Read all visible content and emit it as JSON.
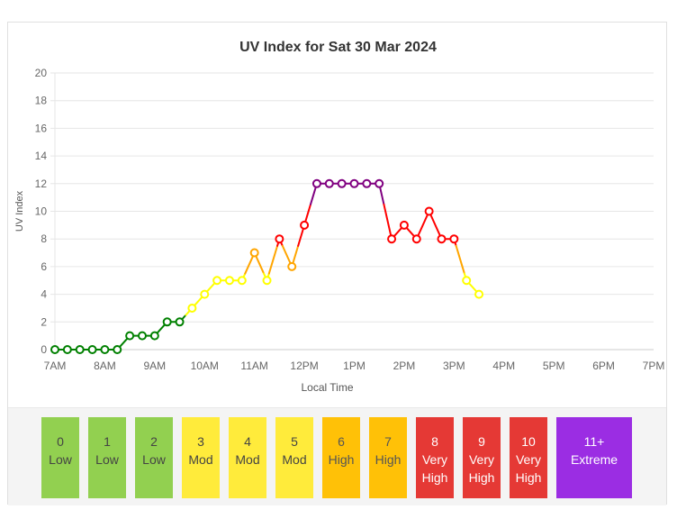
{
  "chart_data": {
    "type": "line",
    "title": "UV Index for Sat 30 Mar 2024",
    "xlabel": "Local Time",
    "ylabel": "UV Index",
    "ylim": [
      0,
      20
    ],
    "yticks": [
      0,
      2,
      4,
      6,
      8,
      10,
      12,
      14,
      16,
      18,
      20
    ],
    "xlim_hours": [
      7,
      19
    ],
    "xticks": [
      {
        "hour": 7,
        "label": "7AM"
      },
      {
        "hour": 8,
        "label": "8AM"
      },
      {
        "hour": 9,
        "label": "9AM"
      },
      {
        "hour": 10,
        "label": "10AM"
      },
      {
        "hour": 11,
        "label": "11AM"
      },
      {
        "hour": 12,
        "label": "12PM"
      },
      {
        "hour": 13,
        "label": "1PM"
      },
      {
        "hour": 14,
        "label": "2PM"
      },
      {
        "hour": 15,
        "label": "3PM"
      },
      {
        "hour": 16,
        "label": "4PM"
      },
      {
        "hour": 17,
        "label": "5PM"
      },
      {
        "hour": 18,
        "label": "6PM"
      },
      {
        "hour": 19,
        "label": "7PM"
      }
    ],
    "grid": true,
    "series": [
      {
        "name": "UV Index",
        "x_hours": [
          7,
          7.25,
          7.5,
          7.75,
          8,
          8.25,
          8.5,
          8.75,
          9,
          9.25,
          9.5,
          9.75,
          10,
          10.25,
          10.5,
          10.75,
          11,
          11.25,
          11.5,
          11.75,
          12,
          12.25,
          12.5,
          12.75,
          13,
          13.25,
          13.5,
          13.75,
          14,
          14.25,
          14.5,
          14.75,
          15,
          15.25,
          15.5
        ],
        "values": [
          0,
          0,
          0,
          0,
          0,
          0,
          1,
          1,
          1,
          2,
          2,
          3,
          4,
          5,
          5,
          5,
          7,
          5,
          8,
          6,
          9,
          12,
          12,
          12,
          12,
          12,
          12,
          8,
          9,
          8,
          10,
          8,
          8,
          5,
          4
        ]
      }
    ],
    "color_bands": [
      {
        "min": 0,
        "max": 2.5,
        "color": "#008000"
      },
      {
        "min": 2.5,
        "max": 5.5,
        "color": "#ffff00"
      },
      {
        "min": 5.5,
        "max": 7.5,
        "color": "#ffa500"
      },
      {
        "min": 7.5,
        "max": 10.5,
        "color": "#ff0000"
      },
      {
        "min": 10.5,
        "max": 100,
        "color": "#800080"
      }
    ]
  },
  "legend": [
    {
      "value": "0",
      "lines": [
        "Low"
      ],
      "bg": "#92d050",
      "fg": "#444444"
    },
    {
      "value": "1",
      "lines": [
        "Low"
      ],
      "bg": "#92d050",
      "fg": "#444444"
    },
    {
      "value": "2",
      "lines": [
        "Low"
      ],
      "bg": "#92d050",
      "fg": "#444444"
    },
    {
      "value": "3",
      "lines": [
        "Mod"
      ],
      "bg": "#ffeb3b",
      "fg": "#444444"
    },
    {
      "value": "4",
      "lines": [
        "Mod"
      ],
      "bg": "#ffeb3b",
      "fg": "#444444"
    },
    {
      "value": "5",
      "lines": [
        "Mod"
      ],
      "bg": "#ffeb3b",
      "fg": "#444444"
    },
    {
      "value": "6",
      "lines": [
        "High"
      ],
      "bg": "#ffc107",
      "fg": "#555555"
    },
    {
      "value": "7",
      "lines": [
        "High"
      ],
      "bg": "#ffc107",
      "fg": "#555555"
    },
    {
      "value": "8",
      "lines": [
        "Very",
        "High"
      ],
      "bg": "#e53935",
      "fg": "#ffffff"
    },
    {
      "value": "9",
      "lines": [
        "Very",
        "High"
      ],
      "bg": "#e53935",
      "fg": "#ffffff"
    },
    {
      "value": "10",
      "lines": [
        "Very",
        "High"
      ],
      "bg": "#e53935",
      "fg": "#ffffff"
    },
    {
      "value": "11+",
      "lines": [
        "Extreme"
      ],
      "bg": "#9b2de3",
      "fg": "#ffffff"
    }
  ]
}
